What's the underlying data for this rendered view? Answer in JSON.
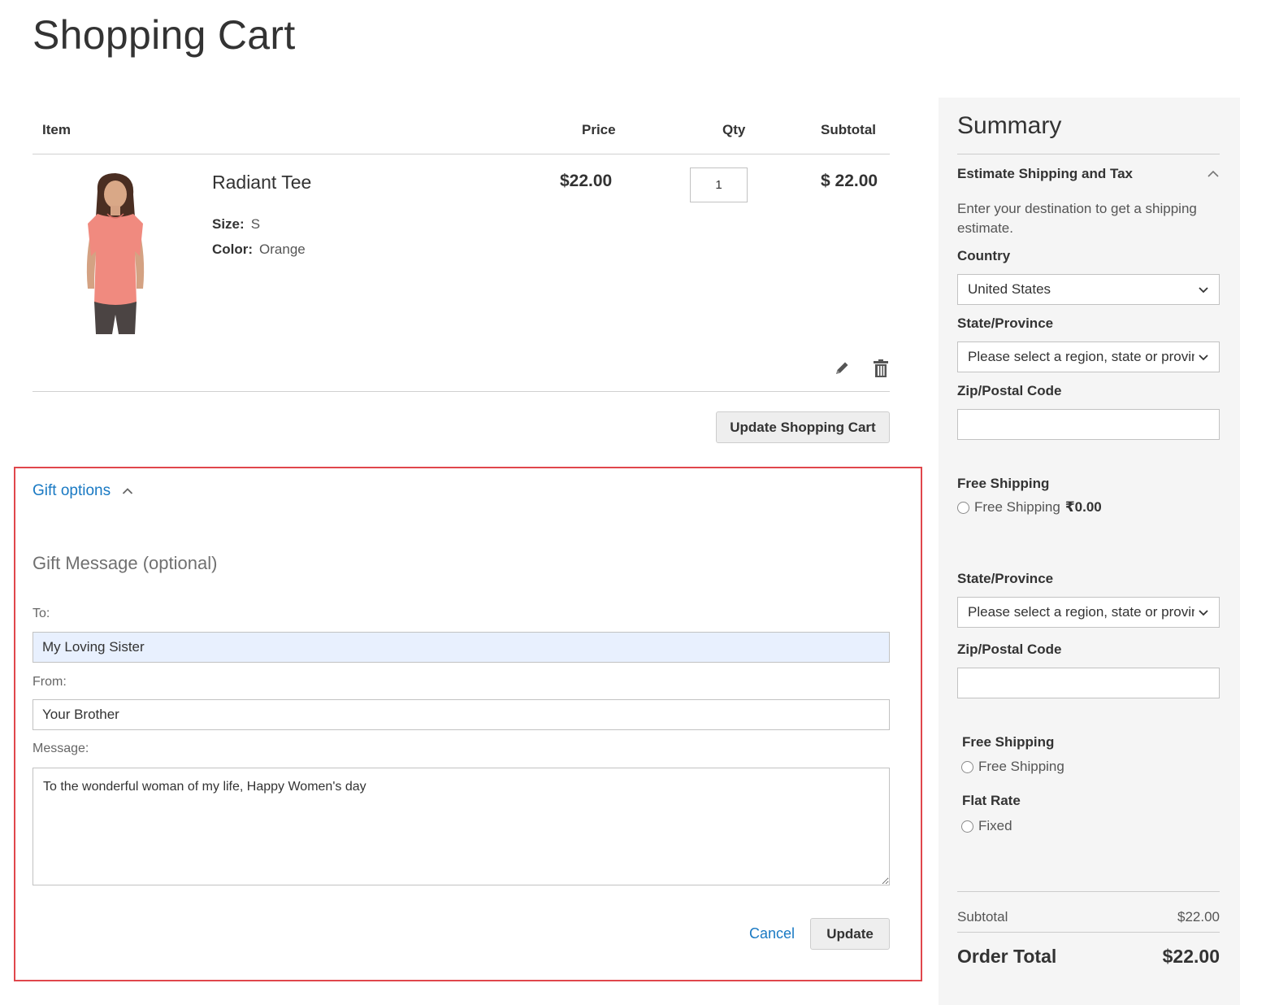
{
  "page_title": "Shopping Cart",
  "cart": {
    "headers": {
      "item": "Item",
      "price": "Price",
      "qty": "Qty",
      "subtotal": "Subtotal"
    },
    "item": {
      "name": "Radiant Tee",
      "size_label": "Size:",
      "size_value": "S",
      "color_label": "Color:",
      "color_value": "Orange",
      "price": "$22.00",
      "qty": "1",
      "subtotal": "$ 22.00"
    },
    "update_button": "Update Shopping Cart"
  },
  "gift": {
    "toggle_label": "Gift options",
    "title": "Gift Message (optional)",
    "to_label": "To:",
    "to_value": "My Loving Sister",
    "from_label": "From:",
    "from_value": "Your Brother",
    "message_label": "Message:",
    "message_value": "To the wonderful woman of my life, Happy Women's day",
    "cancel_label": "Cancel",
    "update_label": "Update",
    "border_color": "#e0474c"
  },
  "summary": {
    "title": "Summary",
    "estimate_title": "Estimate Shipping and Tax",
    "estimate_hint": "Enter your destination to get a shipping estimate.",
    "country_label": "Country",
    "country_value": "United States",
    "state_label": "State/Province",
    "state_placeholder": "Please select a region, state or province.",
    "zip_label": "Zip/Postal Code",
    "method_group_1": {
      "title": "Free Shipping",
      "option_text": "Free Shipping",
      "option_price": "₹0.00"
    },
    "state_label_2": "State/Province",
    "state_placeholder_2": "Please select a region, state or province.",
    "zip_label_2": "Zip/Postal Code",
    "method_group_2": {
      "title": "Free Shipping",
      "option_text": "Free Shipping"
    },
    "method_group_3": {
      "title": "Flat Rate",
      "option_text": "Fixed"
    },
    "subtotal_label": "Subtotal",
    "subtotal_value": "$22.00",
    "order_total_label": "Order Total",
    "order_total_value": "$22.00"
  },
  "colors": {
    "link": "#1979c3",
    "accent_border": "#e0474c",
    "summary_bg": "#f5f5f5"
  }
}
